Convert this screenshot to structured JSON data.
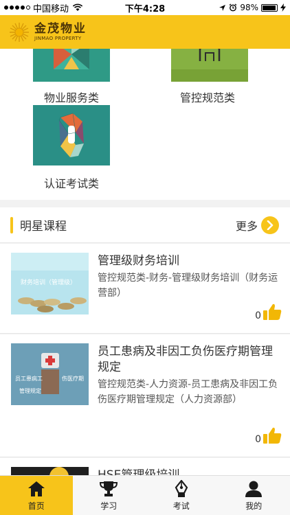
{
  "status_bar": {
    "carrier": "中国移动",
    "time": "下午4:28",
    "battery": "98%"
  },
  "header": {
    "brand_cn": "金茂物业",
    "brand_en": "JINMAO PROPERTY"
  },
  "categories": [
    {
      "label": "物业服务类",
      "icon": "property-service-image"
    },
    {
      "label": "管控规范类",
      "icon": "control-standard-image"
    },
    {
      "label": "认证考试类",
      "icon": "certification-exam-image"
    }
  ],
  "section": {
    "title": "明星课程",
    "more_label": "更多"
  },
  "courses": [
    {
      "title": "管理级财务培训",
      "desc": "管控规范类-财务-管理级财务培训（财务运营部）",
      "likes": "0",
      "thumb_text": "财务培训（管理级）"
    },
    {
      "title": "员工患病及非因工负伤医疗期管理规定",
      "desc": "管控规范类-人力资源-员工患病及非因工负伤医疗期管理规定（人力资源部）",
      "likes": "0",
      "thumb_text_left": "员工患病工",
      "thumb_text_right": "伤医疗期",
      "thumb_text_bottom": "管理规定"
    },
    {
      "title": "HSE管理级培训"
    }
  ],
  "tabs": [
    {
      "label": "首页",
      "icon": "home-icon",
      "active": true
    },
    {
      "label": "学习",
      "icon": "trophy-icon",
      "active": false
    },
    {
      "label": "考试",
      "icon": "exam-pen-icon",
      "active": false
    },
    {
      "label": "我的",
      "icon": "user-icon",
      "active": false
    }
  ],
  "colors": {
    "accent": "#f7c41a",
    "like": "#f2b705"
  }
}
